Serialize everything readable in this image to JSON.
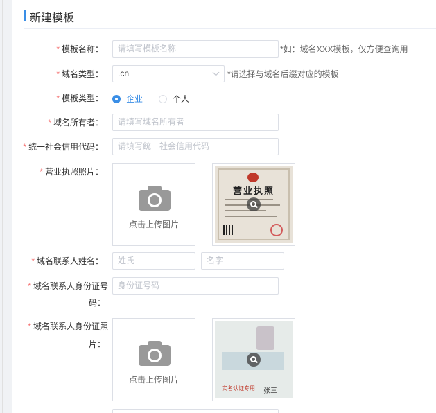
{
  "page_title": "新建模板",
  "form": {
    "template_name": {
      "label": "模板名称：",
      "placeholder": "请填写模板名称",
      "hint": "*如：域名XXX模板，仅方便查询用"
    },
    "domain_type": {
      "label": "域名类型：",
      "value": ".cn",
      "hint": "*请选择与域名后缀对应的模板"
    },
    "template_type": {
      "label": "模板类型：",
      "options": [
        "企业",
        "个人"
      ],
      "selected": "企业"
    },
    "domain_owner": {
      "label": "域名所有者：",
      "placeholder": "请填写域名所有者"
    },
    "credit_code": {
      "label": "统一社会信用代码：",
      "placeholder": "请填写统一社会信用代码"
    },
    "license_photo": {
      "label": "营业执照照片：",
      "upload_text": "点击上传图片"
    },
    "contact_name": {
      "label": "域名联系人姓名：",
      "surname_placeholder": "姓氏",
      "given_placeholder": "名字"
    },
    "contact_id_number": {
      "label_line1": "域名联系人身份证号",
      "label_line2": "码：",
      "placeholder": "身份证号码"
    },
    "contact_id_photo": {
      "label_line1": "域名联系人身份证照",
      "label_line2": "片：",
      "upload_text": "点击上传图片"
    }
  },
  "thumbnails": {
    "license_title": "营业执照",
    "id_sign": "张三",
    "id_stamp": "实名认证专用"
  },
  "colors": {
    "accent": "#3a8ee6",
    "required": "#f56c6c",
    "border": "#dcdfe6"
  },
  "icons": {
    "upload": "camera-icon",
    "preview": "zoom-icon",
    "select": "chevron-down-icon"
  }
}
